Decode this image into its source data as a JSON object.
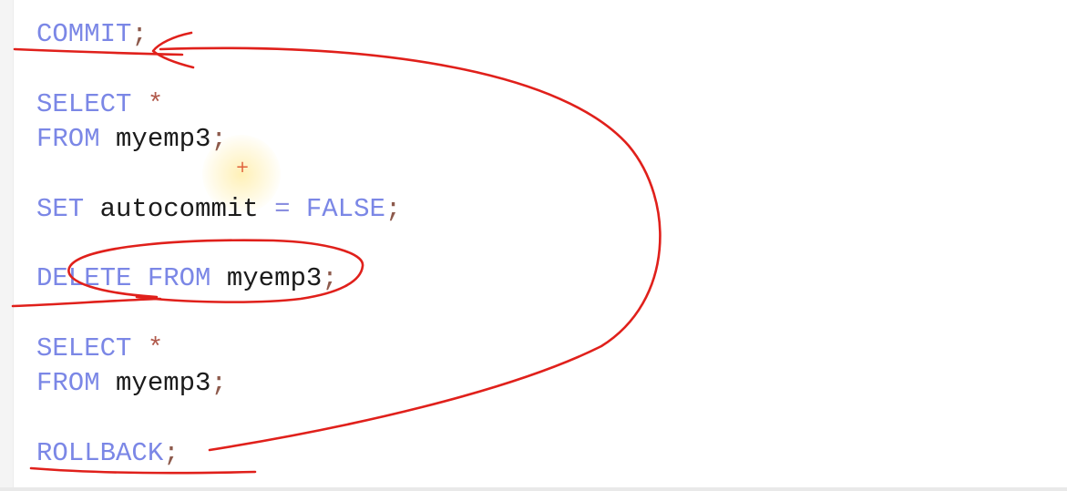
{
  "editor": {
    "lines": {
      "commit": {
        "kw": "COMMIT",
        "semi": ";"
      },
      "select1": {
        "kw": "SELECT",
        "star": "*"
      },
      "from1": {
        "kw": "FROM",
        "ident": "myemp3",
        "semi": ";"
      },
      "set": {
        "kw": "SET",
        "ident": "autocommit",
        "op": "=",
        "val": "FALSE",
        "semi": ";"
      },
      "delete": {
        "kw1": "DELETE",
        "kw2": "FROM",
        "ident": "myemp3",
        "semi": ";"
      },
      "select2": {
        "kw": "SELECT",
        "star": "*"
      },
      "from2": {
        "kw": "FROM",
        "ident": "myemp3",
        "semi": ";"
      },
      "rollback": {
        "kw": "ROLLBACK",
        "semi": ";"
      }
    },
    "cursor_symbol": "+",
    "colors": {
      "keyword": "#7b87e6",
      "identifier": "#1b1b1b",
      "punctuation": "#8d5a4c",
      "annotation": "#e0201b",
      "cursor_highlight": "#ffeeaa"
    }
  }
}
